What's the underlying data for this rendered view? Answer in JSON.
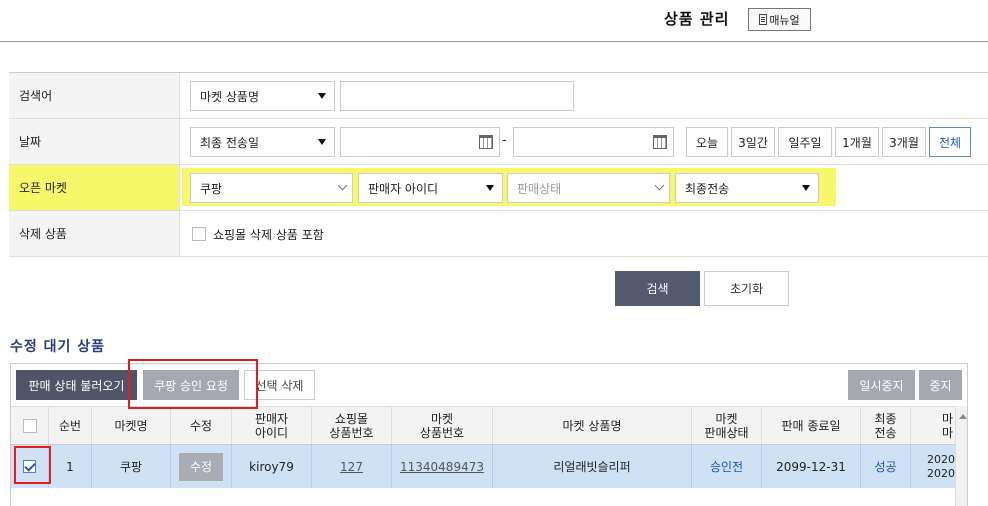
{
  "header": {
    "title": "상품 관리",
    "manual_label": "매뉴얼"
  },
  "search": {
    "rows": [
      {
        "label": "검색어",
        "select": "마켓 상품명",
        "input_value": ""
      },
      {
        "label": "날짜",
        "select": "최종 전송일",
        "from_date": "",
        "to_date": "",
        "range_sep": "-",
        "periods": [
          "오늘",
          "3일간",
          "일주일",
          "1개월",
          "3개월",
          "전체"
        ],
        "active_period": "전체"
      },
      {
        "label": "오픈 마켓",
        "market": "쿠팡",
        "seller_id": "판매자 아이디",
        "sale_status": "판매상태",
        "final_send": "최종전송"
      },
      {
        "label": "삭제 상품",
        "checkbox_label": "쇼핑몰 삭제 상품 포함",
        "checked": false
      }
    ],
    "search_button": "검색",
    "reset_button": "초기화"
  },
  "list": {
    "title": "수정 대기 상품",
    "toolbar": {
      "load_status": "판매 상태 불러오기",
      "coupang_approval": "쿠팡 승인 요청",
      "delete_selected": "선택 삭제",
      "pause": "일시중지",
      "stop": "중지"
    },
    "columns": [
      "순번",
      "마켓명",
      "수정",
      "판매자\n아이디",
      "쇼핑몰\n상품번호",
      "마켓\n상품번호",
      "마켓 상품명",
      "마켓\n판매상태",
      "판매 종료일",
      "최종\n전송",
      "마\n마"
    ],
    "rows": [
      {
        "checked": true,
        "no": "1",
        "market": "쿠팡",
        "edit": "수정",
        "seller_id": "kiroy79",
        "mall_no": "127",
        "market_no": "11340489473",
        "product_name": "리얼래빗슬리퍼",
        "sale_status": "승인전",
        "end_date": "2099-12-31",
        "final_send": "성공",
        "last": "2020\n2020"
      }
    ]
  },
  "colors": {
    "highlight": "#f7f76a",
    "primary_dark": "#525a6e",
    "row_selected": "#cfe2f5",
    "annotation_red": "#e31d1d",
    "status_blue": "#1f4fc8"
  }
}
